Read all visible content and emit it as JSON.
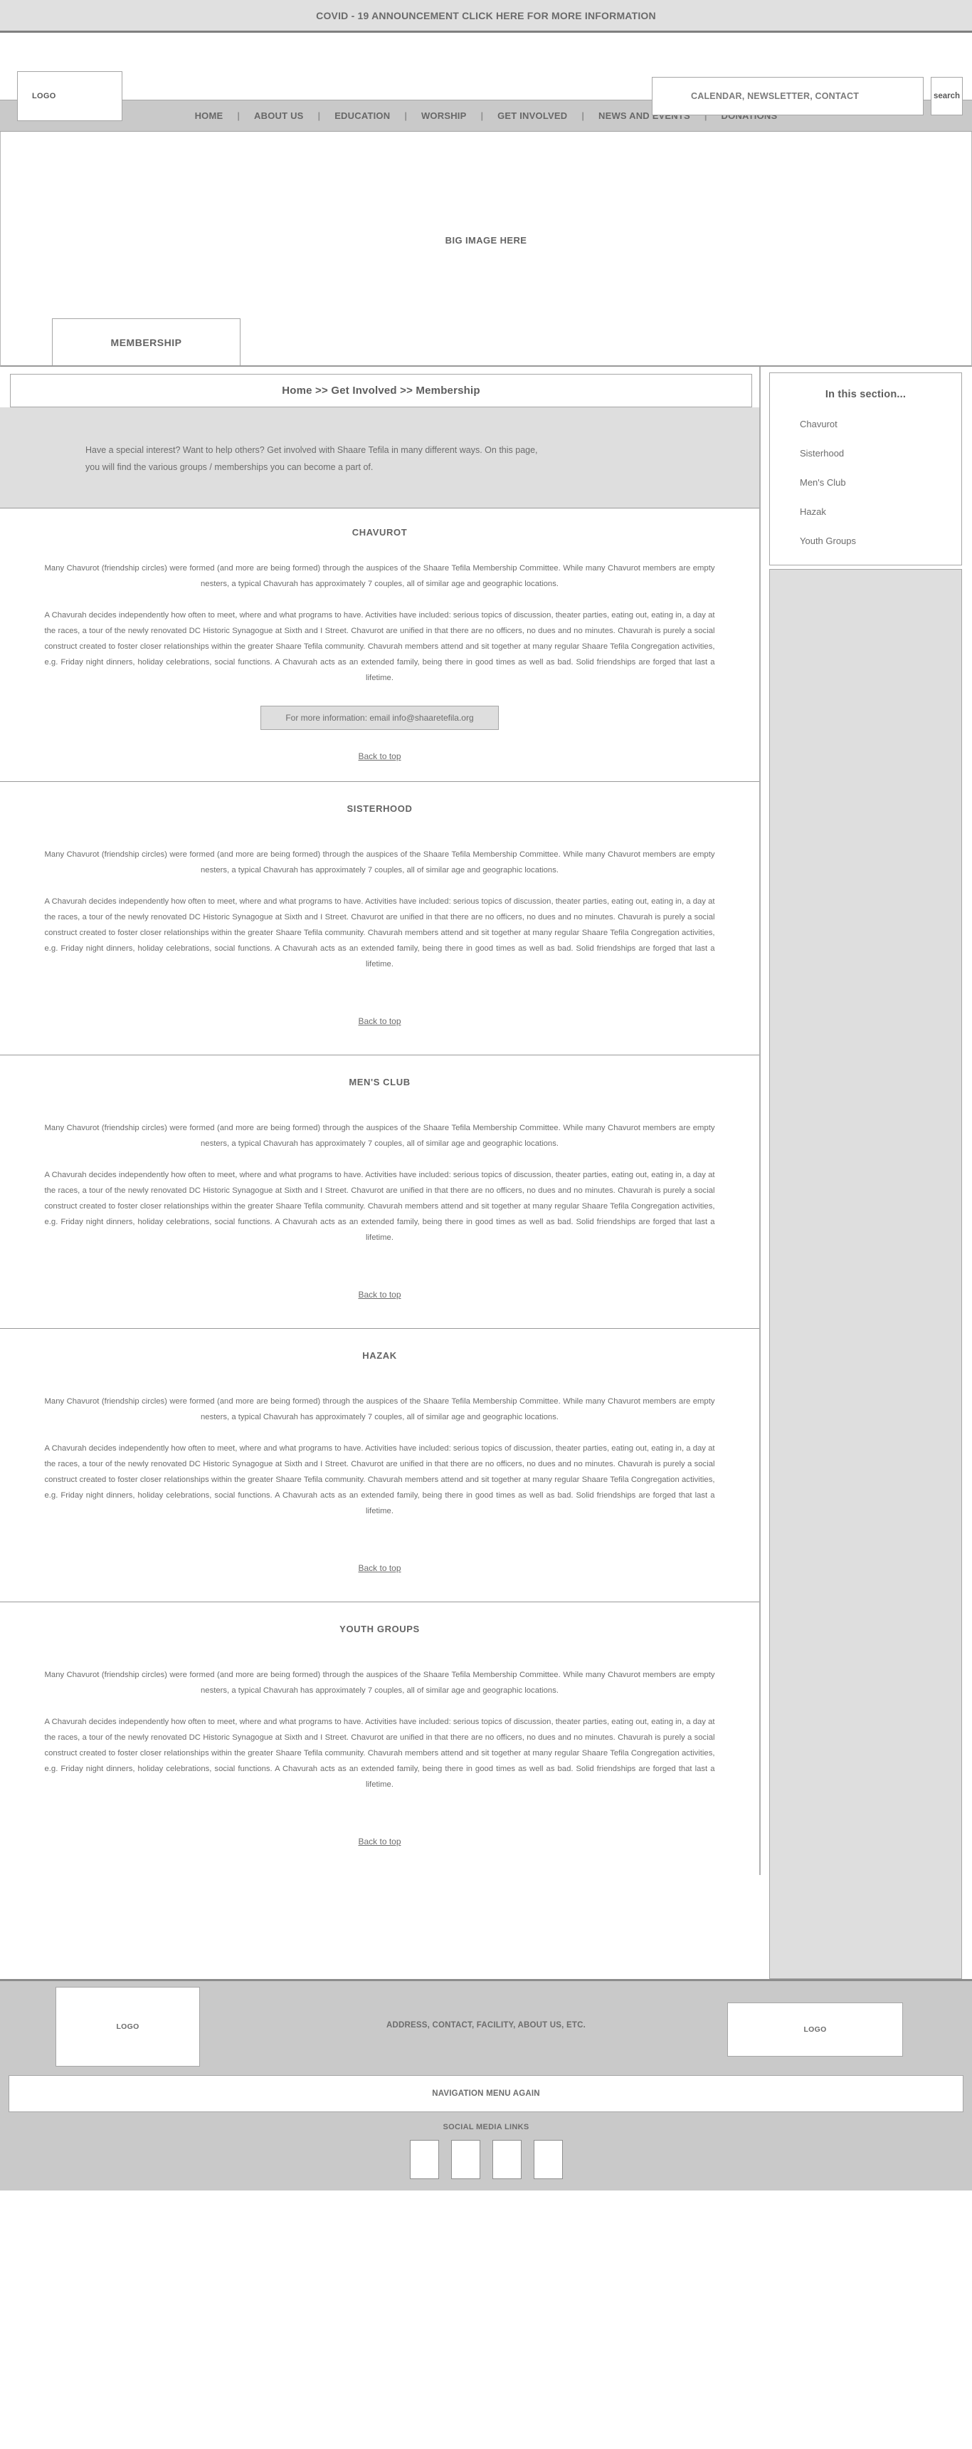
{
  "announcement": {
    "text": "COVID - 19 ANNOUNCEMENT CLICK HERE FOR MORE INFORMATION"
  },
  "header": {
    "logo_label": "LOGO",
    "search_value": "CALENDAR, NEWSLETTER, CONTACT",
    "search_placeholder": "CALENDAR, NEWSLETTER, CONTACT",
    "search_button": "search"
  },
  "nav": {
    "items": [
      "HOME",
      "ABOUT US",
      "EDUCATION",
      "WORSHIP",
      "GET INVOLVED",
      "NEWS AND EVENTS",
      "DONATIONS"
    ],
    "separator": "|"
  },
  "hero": {
    "placeholder_label": "BIG IMAGE HERE",
    "tab_label": "MEMBERSHIP"
  },
  "breadcrumb": {
    "text": "Home >> Get Involved >> Membership"
  },
  "intro": {
    "text": "Have a special interest?  Want to help others?  Get involved with Shaare Tefila in many different ways. On this page, you will find the various groups / memberships you can become a part of."
  },
  "common": {
    "paragraph_1": "Many Chavurot (friendship circles) were formed (and more are being formed) through the auspices of the Shaare Tefila Membership Committee. While many Chavurot members are empty nesters, a typical Chavurah has approximately 7 couples, all of similar age and geographic locations.",
    "paragraph_2": "A Chavurah decides independently how often to meet, where and what programs to have. Activities have included: serious topics of discussion, theater parties, eating out, eating in, a day at the races, a tour of the newly renovated DC Historic Synagogue at Sixth and I Street. Chavurot are unified in that there are no officers, no dues and no minutes. Chavurah is purely a social construct created to foster closer relationships within the greater Shaare Tefila community. Chavurah members attend and sit together at many regular Shaare Tefila Congregation activities, e.g. Friday night dinners, holiday celebrations, social functions. A Chavurah acts as an extended family, being there in good times as well as bad. Solid friendships are forged that last a lifetime.",
    "back_to_top": "Back to top",
    "info_button": "For more information: email info@shaaretefila.org"
  },
  "sections": {
    "chavurot_title": "CHAVUROT",
    "sisterhood_title": "SISTERHOOD",
    "mensclub_title": "MEN'S CLUB",
    "hazak_title": "HAZAK",
    "youth_title": "YOUTH GROUPS"
  },
  "sidebar": {
    "title": "In this section...",
    "items": [
      {
        "label": "Chavurot"
      },
      {
        "label": "Sisterhood"
      },
      {
        "label": "Men's Club"
      },
      {
        "label": "Hazak"
      },
      {
        "label": "Youth Groups"
      }
    ]
  },
  "footer": {
    "logo_left": "LOGO",
    "center_text": "ADDRESS, CONTACT, FACILITY, ABOUT US, ETC.",
    "logo_right": "LOGO",
    "nav_again": "NAVIGATION MENU AGAIN",
    "social_title": "SOCIAL MEDIA LINKS",
    "social_count": 4
  },
  "colors": {
    "announce_bg": "#e0e0e0",
    "nav_bg": "#c9c9c9",
    "panel_bg": "#dedede",
    "text": "#6d6d6d",
    "border": "#a6a6a6"
  }
}
